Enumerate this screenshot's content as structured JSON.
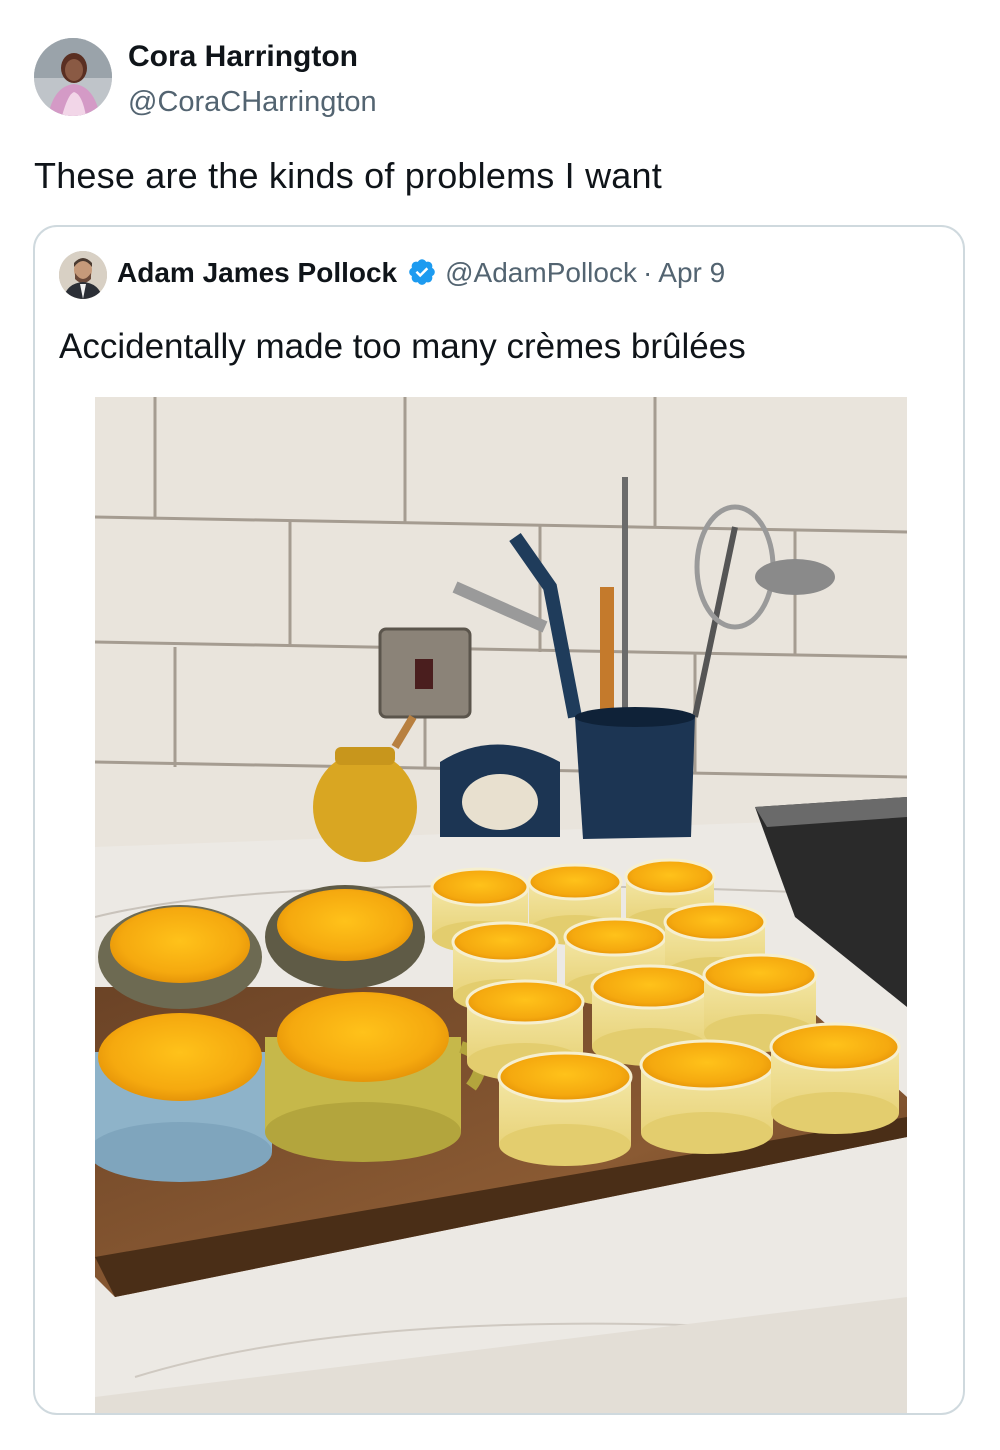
{
  "tweet": {
    "author_name": "Cora Harrington",
    "author_handle": "@CoraCHarrington",
    "text": "These are the kinds of problems I want",
    "avatar_icon": "user-avatar"
  },
  "quoted_tweet": {
    "author_name": "Adam James Pollock",
    "verified": true,
    "verified_icon": "verified-badge-icon",
    "verified_color": "#1d9bf0",
    "author_handle": "@AdamPollock",
    "separator": "·",
    "date": "Apr 9",
    "text": "Accidentally made too many crèmes brûlées",
    "avatar_icon": "user-avatar"
  },
  "colors": {
    "text_primary": "#0f1419",
    "text_secondary": "#536471",
    "card_border": "#cfd9de"
  }
}
